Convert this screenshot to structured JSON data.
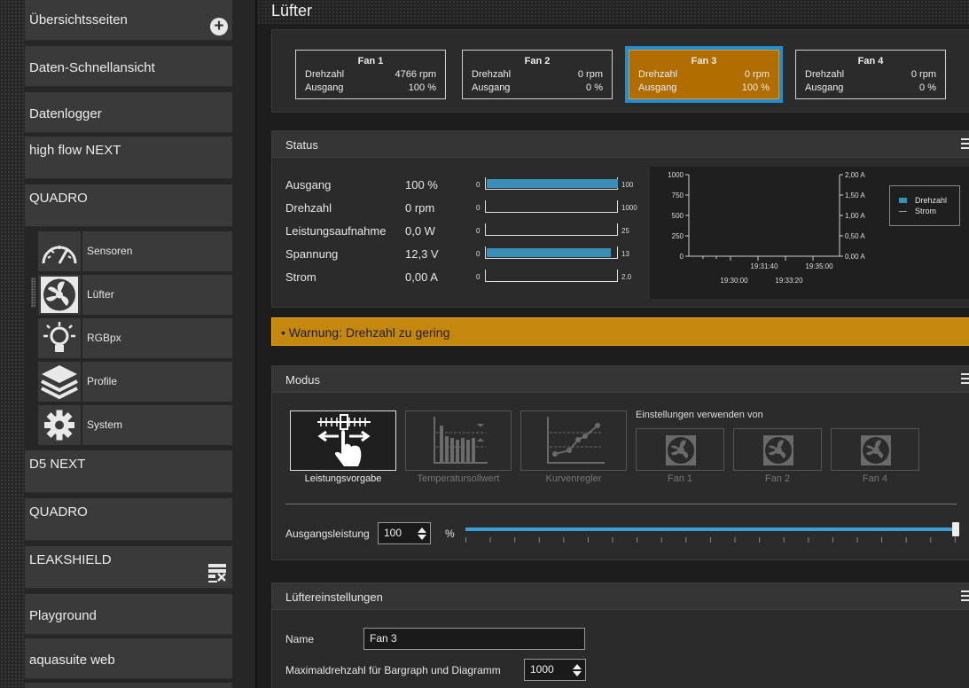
{
  "sidebar": {
    "items": [
      {
        "label": "Übersichtsseiten"
      },
      {
        "label": "Daten-Schnellansicht"
      },
      {
        "label": "Datenlogger"
      },
      {
        "label": "high flow NEXT"
      },
      {
        "label": "QUADRO"
      },
      {
        "label": "D5 NEXT"
      },
      {
        "label": "QUADRO"
      },
      {
        "label": "LEAKSHIELD"
      },
      {
        "label": "Playground"
      },
      {
        "label": "aquasuite web"
      }
    ],
    "subitems": [
      {
        "label": "Sensoren",
        "icon": "gauge-icon"
      },
      {
        "label": "Lüfter",
        "icon": "fan-icon"
      },
      {
        "label": "RGBpx",
        "icon": "lightbulb-icon"
      },
      {
        "label": "Profile",
        "icon": "layers-icon"
      },
      {
        "label": "System",
        "icon": "gear-icon"
      }
    ]
  },
  "page": {
    "title": "Lüfter"
  },
  "fans": [
    {
      "name": "Fan 1",
      "rpm_label": "Drehzahl",
      "rpm": "4766 rpm",
      "out_label": "Ausgang",
      "out": "100 %"
    },
    {
      "name": "Fan 2",
      "rpm_label": "Drehzahl",
      "rpm": "0 rpm",
      "out_label": "Ausgang",
      "out": "0 %"
    },
    {
      "name": "Fan 3",
      "rpm_label": "Drehzahl",
      "rpm": "0 rpm",
      "out_label": "Ausgang",
      "out": "100 %"
    },
    {
      "name": "Fan 4",
      "rpm_label": "Drehzahl",
      "rpm": "0 rpm",
      "out_label": "Ausgang",
      "out": "0 %"
    }
  ],
  "status": {
    "title": "Status",
    "rows": [
      {
        "label": "Ausgang",
        "value": "100 %",
        "min": "0",
        "max": "100",
        "fill": 1.0
      },
      {
        "label": "Drehzahl",
        "value": "0 rpm",
        "min": "0",
        "max": "1000",
        "fill": 0.0
      },
      {
        "label": "Leistungsaufnahme",
        "value": "0,0 W",
        "min": "0",
        "max": "25",
        "fill": 0.0
      },
      {
        "label": "Spannung",
        "value": "12,3 V",
        "min": "0",
        "max": "13",
        "fill": 0.946
      },
      {
        "label": "Strom",
        "value": "0,00 A",
        "min": "0",
        "max": "2.0",
        "fill": 0.0
      }
    ]
  },
  "chart_data": {
    "type": "line",
    "y_left_ticks": [
      "1000",
      "750",
      "500",
      "250",
      "0"
    ],
    "y_right_ticks": [
      "2,00 A",
      "1,50 A",
      "1,00 A",
      "0,50 A",
      "0,00 A"
    ],
    "x_ticks_top": [
      "19:31:40",
      "19:35:00"
    ],
    "x_ticks_bottom": [
      "19:30:00",
      "19:33:20"
    ],
    "ylim": [
      0,
      1000
    ],
    "y2lim": [
      0,
      2
    ],
    "series": [
      {
        "name": "Drehzahl",
        "color": "#3a8fb8",
        "values": []
      },
      {
        "name": "Strom",
        "color": "#9a9a9a",
        "values": []
      }
    ],
    "legend": "top-right"
  },
  "warning": {
    "text": "• Warnung: Drehzahl zu gering"
  },
  "mode": {
    "title": "Modus",
    "options": [
      {
        "label": "Leistungsvorgabe",
        "selected": true
      },
      {
        "label": "Temperatursollwert",
        "selected": false
      },
      {
        "label": "Kurvenregler",
        "selected": false
      }
    ],
    "use_settings_label": "Einstellungen verwenden von",
    "use_from": [
      {
        "label": "Fan 1"
      },
      {
        "label": "Fan 2"
      },
      {
        "label": "Fan 4"
      }
    ],
    "output_label": "Ausgangsleistung",
    "output_value": "100",
    "output_unit": "%",
    "slider_value": 100
  },
  "settings": {
    "title": "Lüftereinstellungen",
    "name_label": "Name",
    "name_value": "Fan 3",
    "max_label": "Maximaldrehzahl für Bargraph und Diagramm",
    "max_value": "1000"
  }
}
